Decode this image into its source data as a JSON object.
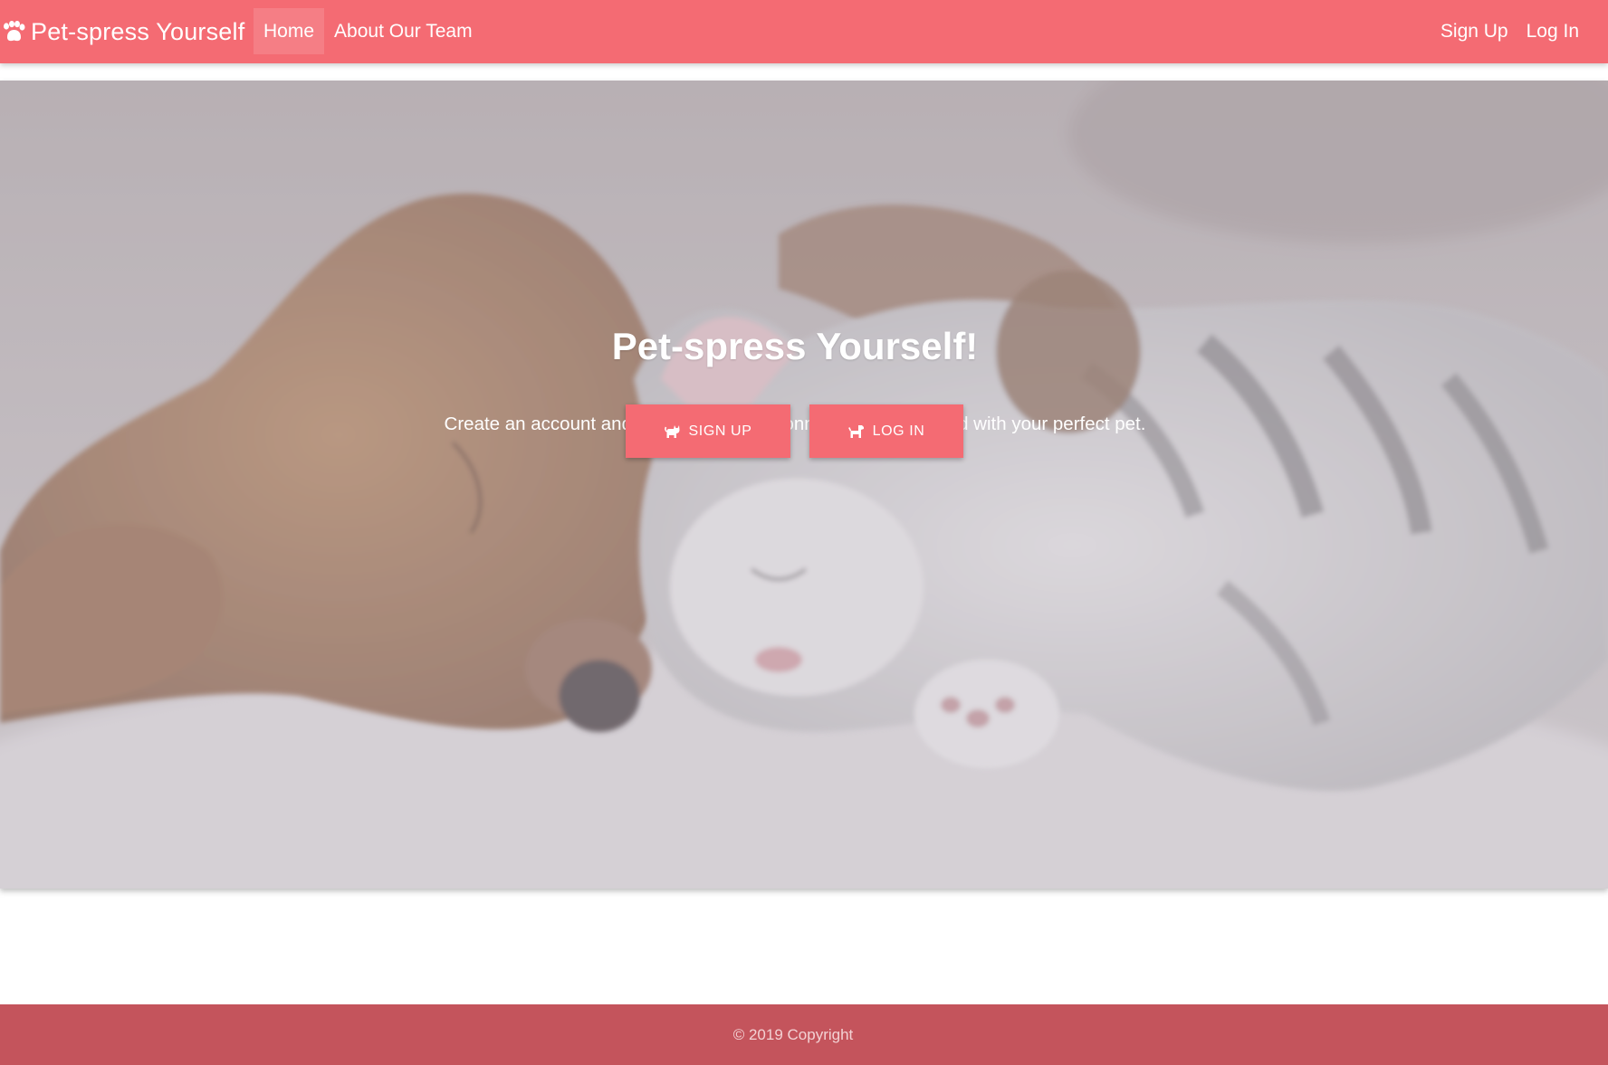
{
  "brand": {
    "name": "Pet-spress Yourself",
    "icon": "paw-icon"
  },
  "nav": {
    "left": [
      {
        "label": "Home",
        "active": true
      },
      {
        "label": "About Our Team",
        "active": false
      }
    ],
    "right": [
      {
        "label": "Sign Up"
      },
      {
        "label": "Log In"
      }
    ]
  },
  "hero": {
    "title": "Pet-spress Yourself!",
    "subtitle": "Create an account and answer our questionnaire to be matched with your perfect pet.",
    "signup_button": "SIGN UP",
    "signup_icon": "cat-icon",
    "login_button": "LOG IN",
    "login_icon": "dog-icon"
  },
  "footer": {
    "copyright": "© 2019 Copyright"
  },
  "colors": {
    "primary": "#f46b73",
    "footer": "#c4545c",
    "text_on_primary": "#ffffff"
  }
}
